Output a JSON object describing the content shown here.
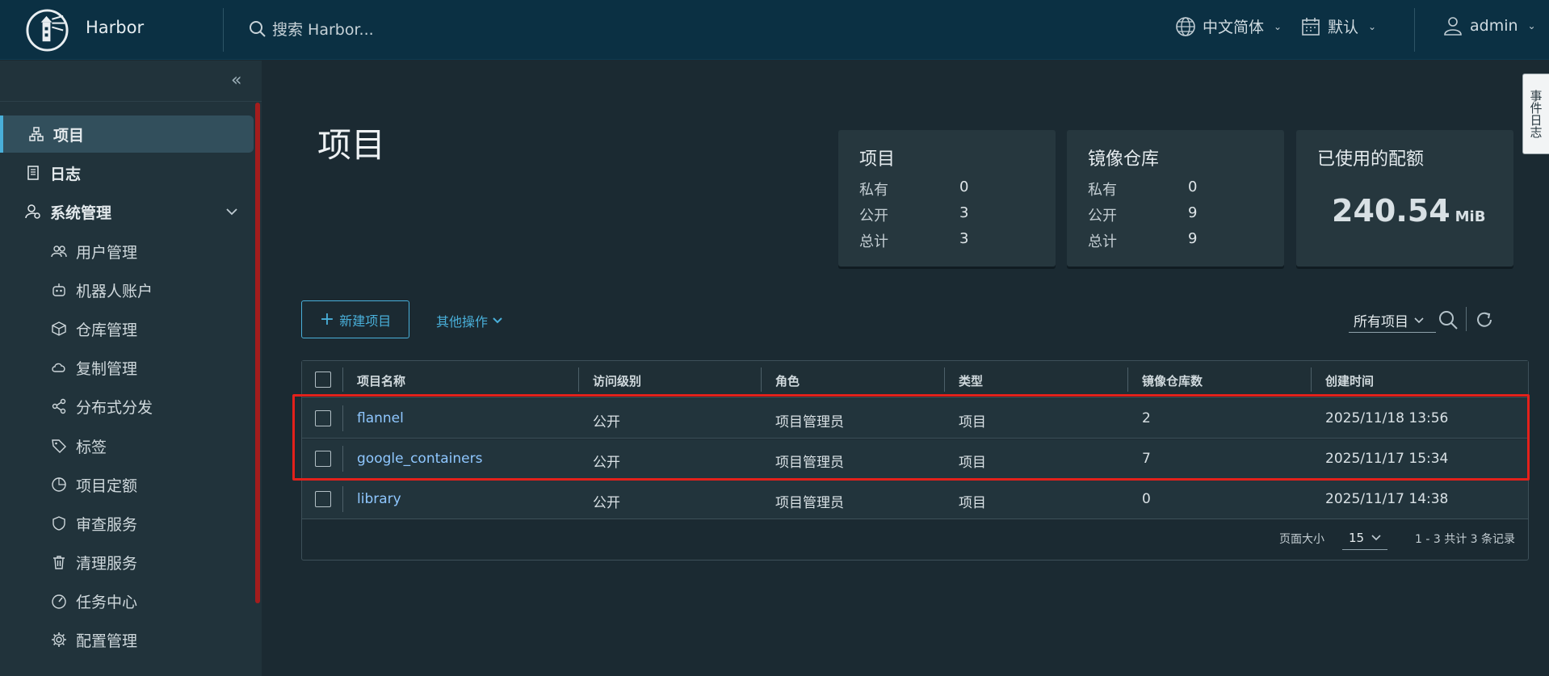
{
  "app": {
    "brand": "Harbor",
    "search_placeholder": "搜索 Harbor...",
    "language": "中文简体",
    "calendar": "默认",
    "user": "admin"
  },
  "sidebar": {
    "items": [
      {
        "label": "项目",
        "icon": "projects-icon",
        "active": true
      },
      {
        "label": "日志",
        "icon": "logs-icon"
      },
      {
        "label": "系统管理",
        "icon": "admin-icon",
        "expanded": true
      }
    ],
    "subitems": [
      {
        "label": "用户管理",
        "icon": "users-icon"
      },
      {
        "label": "机器人账户",
        "icon": "robot-icon"
      },
      {
        "label": "仓库管理",
        "icon": "registry-icon"
      },
      {
        "label": "复制管理",
        "icon": "replication-icon"
      },
      {
        "label": "分布式分发",
        "icon": "share-icon"
      },
      {
        "label": "标签",
        "icon": "tag-icon"
      },
      {
        "label": "项目定额",
        "icon": "quota-icon"
      },
      {
        "label": "审查服务",
        "icon": "shield-icon"
      },
      {
        "label": "清理服务",
        "icon": "trash-icon"
      },
      {
        "label": "任务中心",
        "icon": "dashboard-icon"
      },
      {
        "label": "配置管理",
        "icon": "gear-icon"
      }
    ]
  },
  "main": {
    "title": "项目",
    "cards": {
      "projects": {
        "title": "项目",
        "rows": [
          {
            "label": "私有",
            "value": "0"
          },
          {
            "label": "公开",
            "value": "3"
          },
          {
            "label": "总计",
            "value": "3"
          }
        ]
      },
      "repos": {
        "title": "镜像仓库",
        "rows": [
          {
            "label": "私有",
            "value": "0"
          },
          {
            "label": "公开",
            "value": "9"
          },
          {
            "label": "总计",
            "value": "9"
          }
        ]
      },
      "quota": {
        "title": "已使用的配额",
        "value": "240.54",
        "unit": "MiB"
      }
    },
    "new_project": "新建项目",
    "other_actions": "其他操作",
    "filter": "所有项目",
    "event_log": "事件日志"
  },
  "table": {
    "headers": [
      "项目名称",
      "访问级别",
      "角色",
      "类型",
      "镜像仓库数",
      "创建时间"
    ],
    "rows": [
      {
        "name": "flannel",
        "access": "公开",
        "role": "项目管理员",
        "type": "项目",
        "repos": "2",
        "created": "2025/11/18 13:56"
      },
      {
        "name": "google_containers",
        "access": "公开",
        "role": "项目管理员",
        "type": "项目",
        "repos": "7",
        "created": "2025/11/17 15:34"
      },
      {
        "name": "library",
        "access": "公开",
        "role": "项目管理员",
        "type": "项目",
        "repos": "0",
        "created": "2025/11/17 14:38"
      }
    ],
    "page_size_label": "页面大小",
    "page_size": "15",
    "count_text": "1 - 3 共计 3 条记录"
  },
  "colors": {
    "header": "#0b3043",
    "sidebar": "#21333b",
    "accent": "#49afd9",
    "highlight": "#e3211b"
  }
}
